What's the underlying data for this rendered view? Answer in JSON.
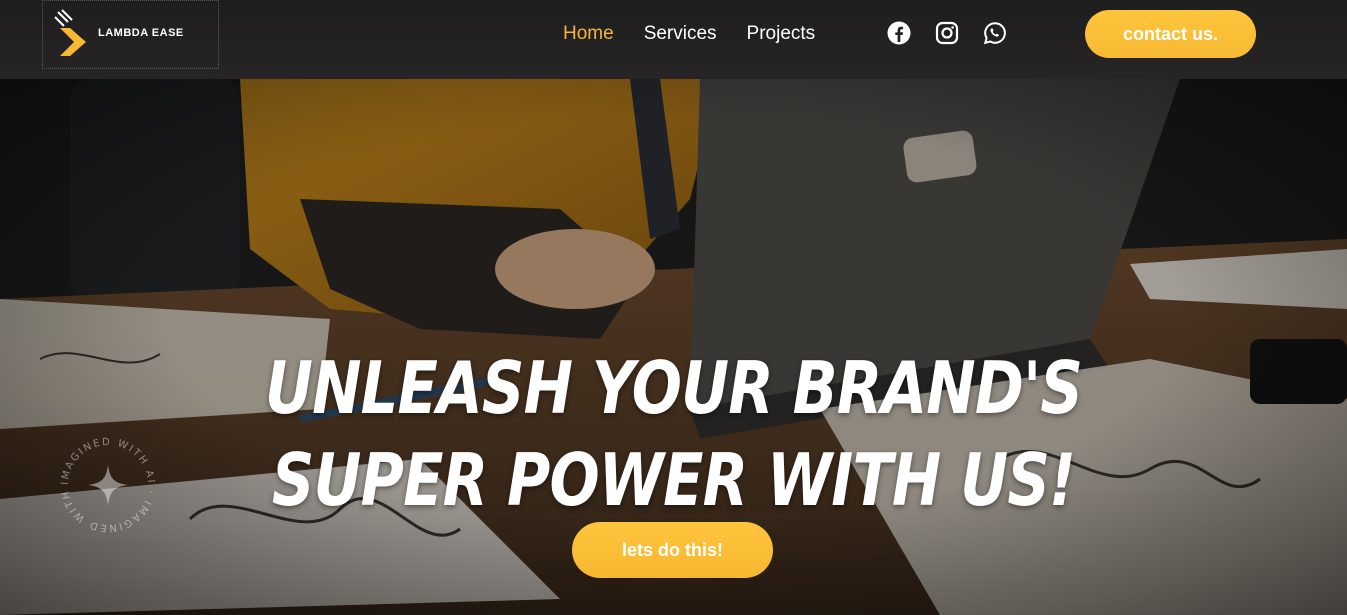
{
  "header": {
    "logo_text": "LAMBDA EASE",
    "nav": [
      {
        "label": "Home",
        "active": true
      },
      {
        "label": "Services",
        "active": false
      },
      {
        "label": "Projects",
        "active": false
      }
    ],
    "social": [
      "facebook-icon",
      "instagram-icon",
      "whatsapp-icon"
    ],
    "contact_label": "contact us."
  },
  "hero": {
    "title_line1": "Unleash your brand's",
    "title_line2": "super power with us!",
    "cta_label": "lets do this!",
    "watermark_text": "IMAGINED WITH AI · IMAGINED WITH AI ·"
  },
  "colors": {
    "accent": "#f2b63a",
    "button": "#ffc53d",
    "header_bg": "#1f1e1e"
  }
}
